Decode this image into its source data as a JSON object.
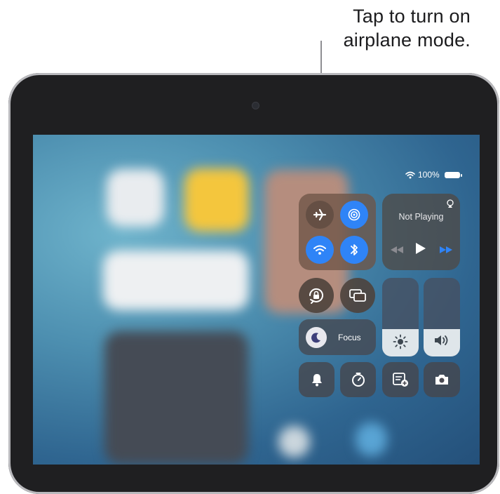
{
  "callout": {
    "line1": "Tap to turn on",
    "line2": "airplane mode."
  },
  "status_bar": {
    "battery": "100%",
    "wifi_icon": "wifi-icon",
    "battery_icon": "battery-icon"
  },
  "control_center": {
    "connectivity": [
      {
        "name": "airplane-mode",
        "icon": "airplane-icon",
        "state": "off",
        "color": "#6b5549"
      },
      {
        "name": "airdrop",
        "icon": "airdrop-icon",
        "state": "on",
        "color": "#2f84f7"
      },
      {
        "name": "wifi",
        "icon": "wifi-icon",
        "state": "on",
        "color": "#2f84f7"
      },
      {
        "name": "bluetooth",
        "icon": "bluetooth-icon",
        "state": "on",
        "color": "#2f84f7"
      }
    ],
    "now_playing": {
      "label": "Not Playing",
      "airplay_icon": "airplay-icon",
      "controls": [
        "rewind-icon",
        "play-icon",
        "forward-icon"
      ]
    },
    "focus": {
      "label": "Focus",
      "icon": "moon-icon"
    },
    "brightness": {
      "icon": "sun-icon",
      "level": 0.35
    },
    "volume": {
      "icon": "speaker-icon",
      "level": 0.35
    },
    "bottom_row": [
      "bell-icon",
      "timer-icon",
      "note-add-icon",
      "camera-icon"
    ],
    "small_buttons": [
      "rotation-lock-icon",
      "screen-mirroring-icon"
    ]
  }
}
